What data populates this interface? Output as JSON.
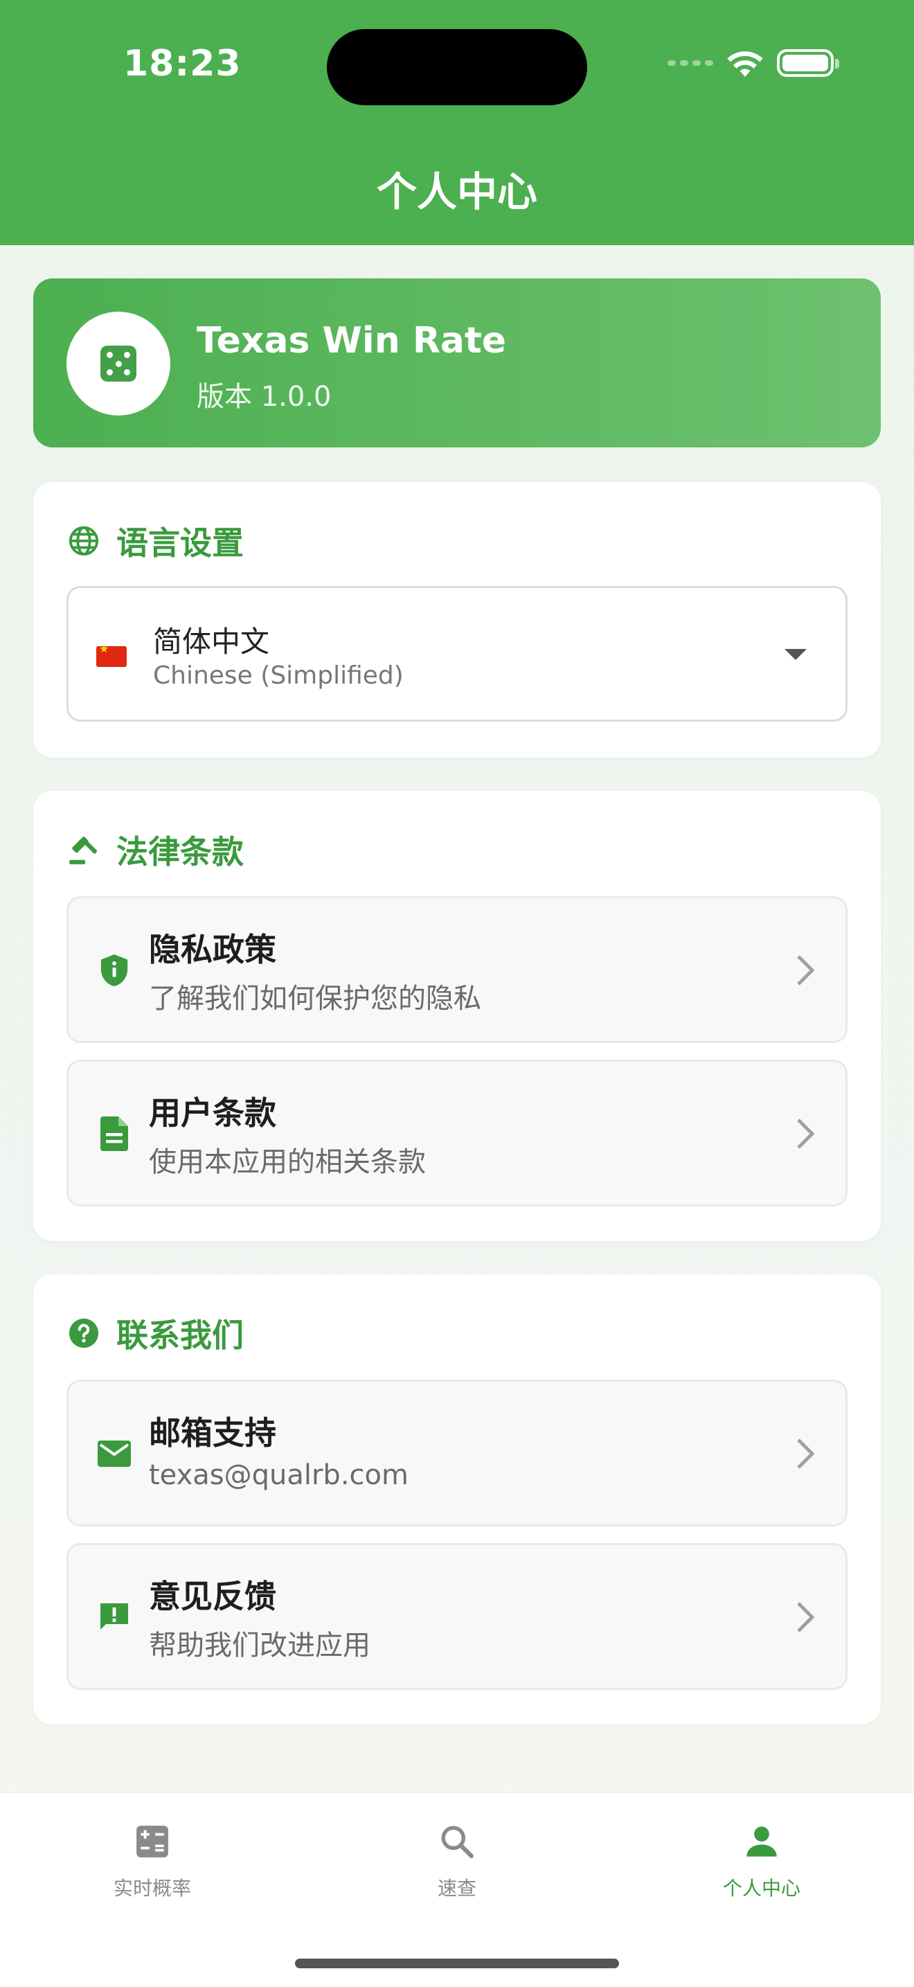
{
  "status_bar": {
    "time": "18:23"
  },
  "header": {
    "title": "个人中心"
  },
  "app_info": {
    "name": "Texas Win Rate",
    "version": "版本 1.0.0",
    "logo_icon": "dice-icon"
  },
  "language": {
    "title": "语言设置",
    "icon": "globe-icon",
    "selected_name": "简体中文",
    "selected_subtitle": "Chinese (Simplified)",
    "flag_icon": "china-flag-icon"
  },
  "legal": {
    "title": "法律条款",
    "icon": "gavel-icon",
    "items": [
      {
        "title": "隐私政策",
        "subtitle": "了解我们如何保护您的隐私",
        "icon": "shield-info-icon"
      },
      {
        "title": "用户条款",
        "subtitle": "使用本应用的相关条款",
        "icon": "document-icon"
      }
    ]
  },
  "contact": {
    "title": "联系我们",
    "icon": "help-circle-icon",
    "items": [
      {
        "title": "邮箱支持",
        "subtitle": "texas@qualrb.com",
        "icon": "mail-icon"
      },
      {
        "title": "意见反馈",
        "subtitle": "帮助我们改进应用",
        "icon": "feedback-icon"
      }
    ]
  },
  "tabs": [
    {
      "label": "实时概率",
      "icon": "calculator-icon",
      "active": false
    },
    {
      "label": "速查",
      "icon": "search-icon",
      "active": false
    },
    {
      "label": "个人中心",
      "icon": "person-icon",
      "active": true
    }
  ],
  "colors": {
    "primary": "#4caf50",
    "accent_text": "#3a9a3d",
    "tab_inactive": "#8a8a8a"
  }
}
